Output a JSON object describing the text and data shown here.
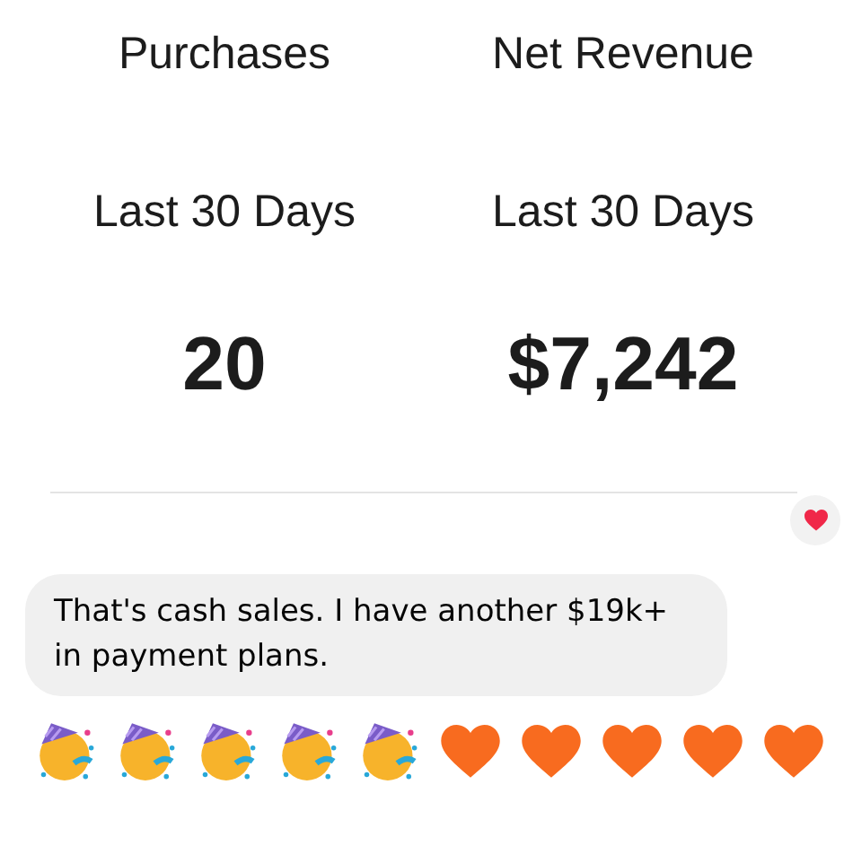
{
  "stats": [
    {
      "title": "Purchases",
      "period": "Last 30 Days",
      "value": "20"
    },
    {
      "title": "Net Revenue",
      "period": "Last 30 Days",
      "value": "$7,242"
    }
  ],
  "reaction": {
    "kind": "heart"
  },
  "message": {
    "text": "That's cash sales. I have another $19k+ in payment plans."
  },
  "emojis": [
    {
      "kind": "party"
    },
    {
      "kind": "party"
    },
    {
      "kind": "party"
    },
    {
      "kind": "party"
    },
    {
      "kind": "party"
    },
    {
      "kind": "heart"
    },
    {
      "kind": "heart"
    },
    {
      "kind": "heart"
    },
    {
      "kind": "heart"
    },
    {
      "kind": "heart"
    }
  ]
}
